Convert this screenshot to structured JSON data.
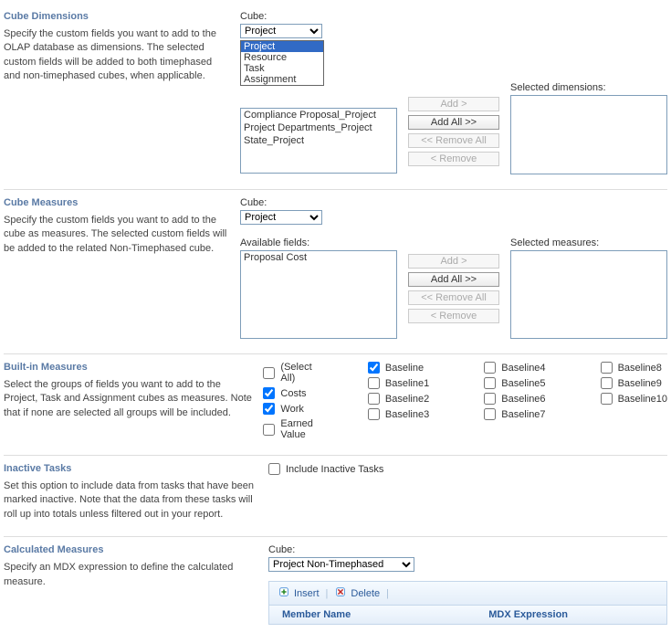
{
  "cube_dimensions": {
    "heading": "Cube Dimensions",
    "desc": "Specify the custom fields you want to add to the OLAP database as dimensions. The selected custom fields will be added to both timephased and non-timephased cubes, when applicable.",
    "cube_label": "Cube:",
    "cube_value": "Project",
    "dropdown_options": [
      "Project",
      "Resource",
      "Task",
      "Assignment"
    ],
    "available_label": "",
    "available_fields": [
      "Compliance Proposal_Project",
      "Project Departments_Project",
      "State_Project"
    ],
    "selected_label": "Selected dimensions:",
    "buttons": {
      "add": "Add >",
      "add_all": "Add All >>",
      "remove_all": "<< Remove All",
      "remove": "< Remove"
    }
  },
  "cube_measures": {
    "heading": "Cube Measures",
    "desc": "Specify the custom fields you want to add to the cube as measures. The selected custom fields will be added to the related Non-Timephased cube.",
    "cube_label": "Cube:",
    "cube_value": "Project",
    "available_label": "Available fields:",
    "available_fields": [
      "Proposal Cost"
    ],
    "selected_label": "Selected measures:",
    "buttons": {
      "add": "Add >",
      "add_all": "Add All >>",
      "remove_all": "<< Remove All",
      "remove": "< Remove"
    }
  },
  "builtin_measures": {
    "heading": "Built-in Measures",
    "desc": "Select the groups of fields you want to add to the Project, Task and Assignment cubes as measures. Note that if none are selected all groups will be included.",
    "checks": {
      "select_all": {
        "label": "(Select All)",
        "checked": false
      },
      "costs": {
        "label": "Costs",
        "checked": true
      },
      "work": {
        "label": "Work",
        "checked": true
      },
      "earned": {
        "label": "Earned Value",
        "checked": false
      },
      "baseline": {
        "label": "Baseline",
        "checked": true
      },
      "baseline1": {
        "label": "Baseline1",
        "checked": false
      },
      "baseline2": {
        "label": "Baseline2",
        "checked": false
      },
      "baseline3": {
        "label": "Baseline3",
        "checked": false
      },
      "baseline4": {
        "label": "Baseline4",
        "checked": false
      },
      "baseline5": {
        "label": "Baseline5",
        "checked": false
      },
      "baseline6": {
        "label": "Baseline6",
        "checked": false
      },
      "baseline7": {
        "label": "Baseline7",
        "checked": false
      },
      "baseline8": {
        "label": "Baseline8",
        "checked": false
      },
      "baseline9": {
        "label": "Baseline9",
        "checked": false
      },
      "baseline10": {
        "label": "Baseline10",
        "checked": false
      }
    }
  },
  "inactive_tasks": {
    "heading": "Inactive Tasks",
    "desc": "Set this option to include data from tasks that have been marked inactive. Note that the data from these tasks will roll up into totals unless filtered out in your report.",
    "checkbox_label": "Include Inactive Tasks",
    "checked": false
  },
  "calculated_measures": {
    "heading": "Calculated Measures",
    "desc": "Specify an MDX expression to define the calculated measure.",
    "cube_label": "Cube:",
    "cube_value": "Project Non-Timephased",
    "toolbar": {
      "insert": "Insert",
      "delete": "Delete"
    },
    "table_headers": {
      "member": "Member Name",
      "mdx": "MDX Expression"
    }
  }
}
